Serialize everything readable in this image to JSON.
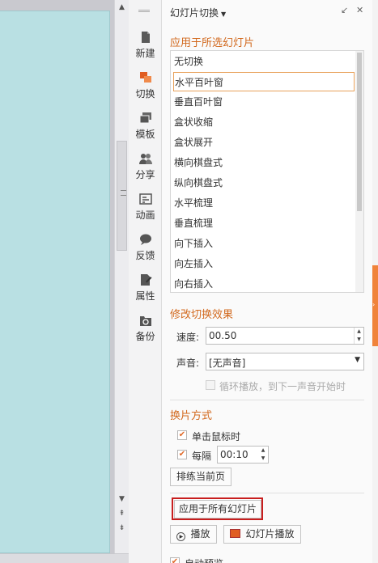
{
  "nav": {
    "items": [
      {
        "label": "新建",
        "icon": "document-icon"
      },
      {
        "label": "切换",
        "icon": "transition-icon"
      },
      {
        "label": "模板",
        "icon": "template-icon"
      },
      {
        "label": "分享",
        "icon": "share-icon"
      },
      {
        "label": "动画",
        "icon": "animation-icon"
      },
      {
        "label": "反馈",
        "icon": "feedback-icon"
      },
      {
        "label": "属性",
        "icon": "properties-icon"
      },
      {
        "label": "备份",
        "icon": "backup-icon"
      }
    ],
    "active": "切换"
  },
  "panel": {
    "title": "幻灯片切换",
    "apply_selected_heading": "应用于所选幻灯片",
    "transitions": [
      "无切换",
      "水平百叶窗",
      "垂直百叶窗",
      "盒状收缩",
      "盒状展开",
      "横向棋盘式",
      "纵向棋盘式",
      "水平梳理",
      "垂直梳理",
      "向下插入",
      "向左插入",
      "向右插入"
    ],
    "selected_transition": "水平百叶窗",
    "modify_heading": "修改切换效果",
    "speed_label": "速度:",
    "speed_value": "00.50",
    "sound_label": "声音:",
    "sound_value": "[无声音]",
    "loop_label": "循环播放，到下一声音开始时",
    "advance_heading": "换片方式",
    "on_click_label": "单击鼠标时",
    "every_label": "每隔",
    "every_value": "00:10",
    "rehearse_label": "排练当前页",
    "apply_all_label": "应用于所有幻灯片",
    "play_label": "播放",
    "slideshow_label": "幻灯片播放",
    "autopreview_label": "自动预览"
  },
  "colors": {
    "accent": "#d2691e",
    "highlight": "#c81e1e",
    "slide": "#b9e0e3",
    "orange_tab": "#f0833a"
  }
}
